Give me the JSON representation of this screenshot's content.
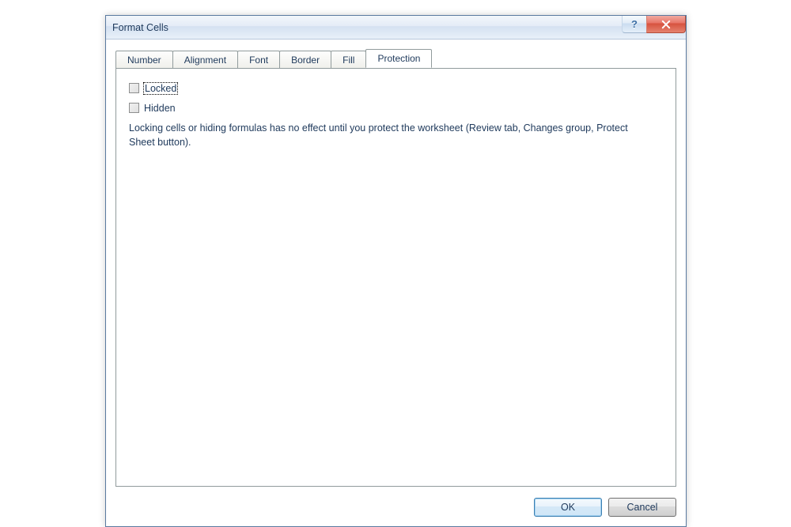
{
  "dialog": {
    "title": "Format Cells",
    "help_symbol": "?",
    "close_symbol": "✕"
  },
  "tabs": {
    "number": "Number",
    "alignment": "Alignment",
    "font": "Font",
    "border": "Border",
    "fill": "Fill",
    "protection": "Protection"
  },
  "protection_panel": {
    "locked_label": "Locked",
    "hidden_label": "Hidden",
    "description": "Locking cells or hiding formulas has no effect until you protect the worksheet (Review tab, Changes group, Protect Sheet button)."
  },
  "buttons": {
    "ok": "OK",
    "cancel": "Cancel"
  }
}
